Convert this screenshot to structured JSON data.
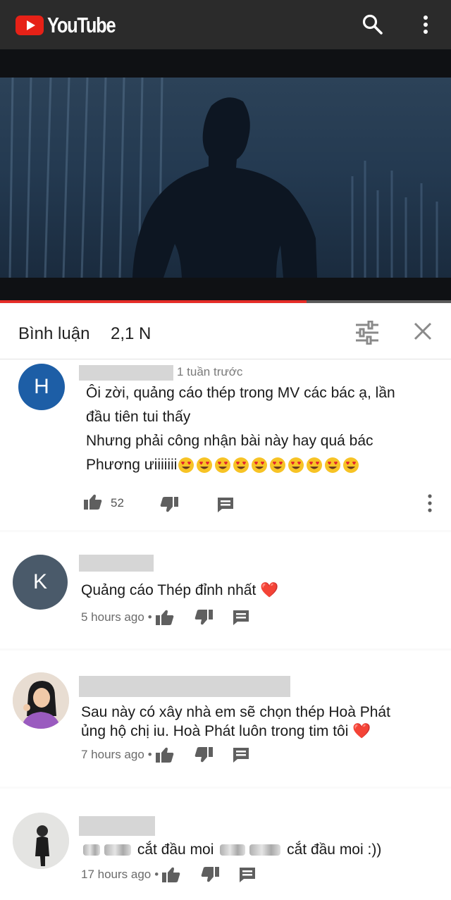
{
  "app": {
    "name": "YouTube",
    "brand_color": "#e62117"
  },
  "header_icons": [
    "search-icon",
    "more-vert-icon"
  ],
  "video": {
    "progress_fraction": 0.68,
    "progress_color": "#e52d27"
  },
  "comments_panel": {
    "title": "Bình luận",
    "count": "2,1 N",
    "icons": [
      "filter-icon",
      "close-icon"
    ]
  },
  "comments": [
    {
      "avatar_letter": "H",
      "avatar_color": "#1d5ea6",
      "time": "1 tuần trước",
      "lines": [
        "Ôi zời, quảng cáo thép trong MV các bác ạ, lần",
        "đầu tiên tui thấy",
        "Nhưng phải công nhận bài này hay quá bác",
        "Phương ưiiiiiii"
      ],
      "emoji": "😍😍😍😍😍😍😍😍😍😍",
      "likes": "52"
    },
    {
      "avatar_letter": "K",
      "avatar_color": "#4a5a6a",
      "text": "Quảng cáo Thép đỉnh nhất",
      "heart": "❤️",
      "time": "5 hours ago",
      "separator": "•"
    },
    {
      "lines": [
        "Sau này có xây nhà em sẽ chọn thép Hoà Phát",
        "ủng hộ chị iu. Hoà Phát luôn trong tim tôi"
      ],
      "heart": "❤️",
      "time": "7 hours ago",
      "separator": "•"
    },
    {
      "text_part_1": "cắt đầu moi",
      "text_part_2": "cắt đầu moi :))",
      "time": "17 hours ago",
      "separator": "•"
    }
  ]
}
